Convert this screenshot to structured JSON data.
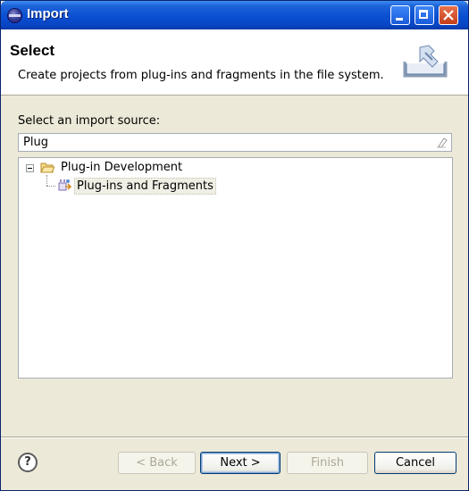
{
  "window": {
    "title": "Import",
    "colors": {
      "titlebar": "#0A4FD2",
      "background": "#ECE9D8"
    }
  },
  "titlebar_buttons": {
    "minimize": "minimize-icon",
    "maximize": "maximize-icon",
    "close": "close-icon"
  },
  "banner": {
    "title": "Select",
    "description": "Create projects from plug-ins and fragments in the file system.",
    "icon": "import-icon"
  },
  "source": {
    "label": "Select an import source:",
    "filter_value": "Plug",
    "clear_icon": "clear-filter-icon"
  },
  "tree": {
    "nodes": [
      {
        "label": "Plug-in Development",
        "icon": "folder-open-icon",
        "expanded": true,
        "children": [
          {
            "label": "Plug-ins and Fragments",
            "icon": "plugin-import-icon",
            "selected": true
          }
        ]
      }
    ]
  },
  "footer": {
    "help_icon": "?",
    "back_label": "< Back",
    "next_label": "Next >",
    "finish_label": "Finish",
    "cancel_label": "Cancel"
  }
}
